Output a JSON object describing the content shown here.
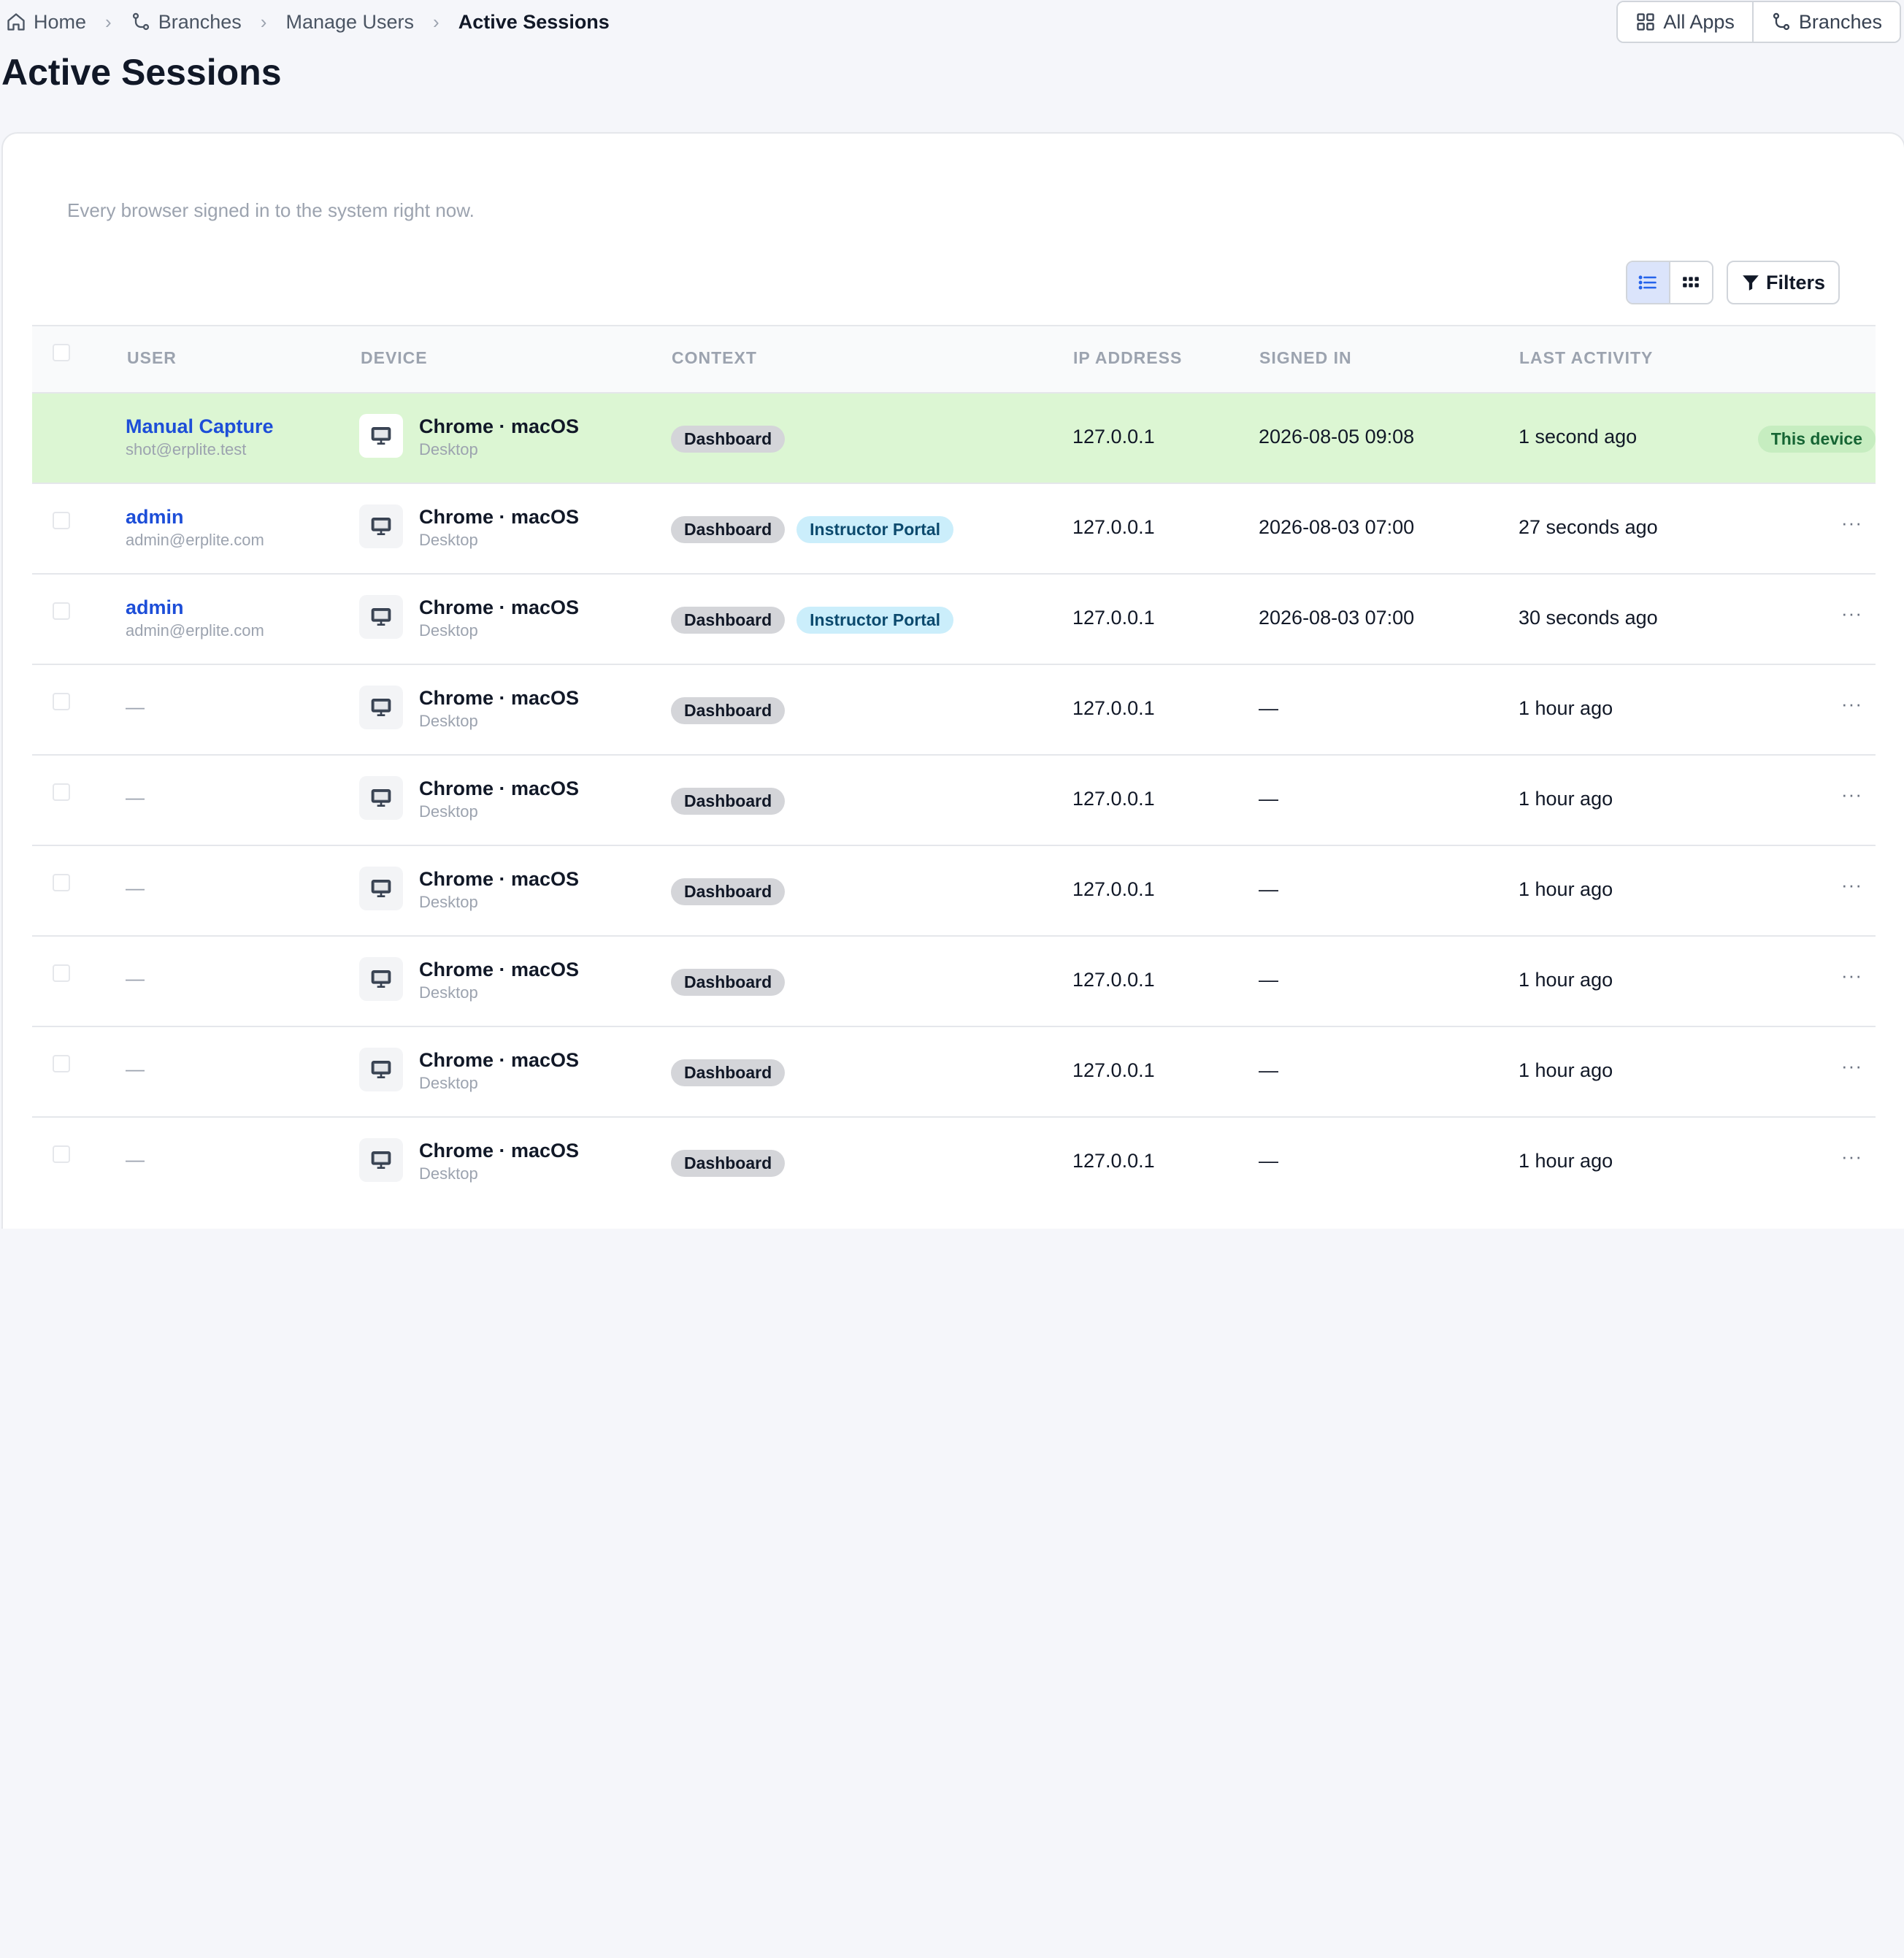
{
  "breadcrumb": {
    "items": [
      "Home",
      "Branches",
      "Manage Users"
    ],
    "current": "Active Sessions",
    "separator": "›"
  },
  "top_buttons": {
    "all_apps": "All Apps",
    "branches": "Branches"
  },
  "page": {
    "title": "Active Sessions"
  },
  "card": {
    "description": "Every browser signed in to the system right now."
  },
  "toolbar": {
    "filters": "Filters"
  },
  "table": {
    "columns": [
      "USER",
      "DEVICE",
      "CONTEXT",
      "IP ADDRESS",
      "SIGNED IN",
      "LAST ACTIVITY"
    ],
    "rows": [
      {
        "user_name": "Manual Capture",
        "user_email": "shot@erplite.test",
        "device": "Chrome · macOS",
        "device_type": "Desktop",
        "tags": [
          "Dashboard"
        ],
        "ip": "127.0.0.1",
        "signed_in": "2026-08-05 09:08",
        "last_activity": "1 second ago",
        "badge": "This device"
      },
      {
        "user_name": "admin",
        "user_email": "admin@erplite.com",
        "device": "Chrome · macOS",
        "device_type": "Desktop",
        "tags": [
          "Dashboard",
          "Instructor Portal"
        ],
        "ip": "127.0.0.1",
        "signed_in": "2026-08-03 07:00",
        "last_activity": "27 seconds ago",
        "action": "···"
      },
      {
        "user_name": "admin",
        "user_email": "admin@erplite.com",
        "device": "Chrome · macOS",
        "device_type": "Desktop",
        "tags": [
          "Dashboard",
          "Instructor Portal"
        ],
        "ip": "127.0.0.1",
        "signed_in": "2026-08-03 07:00",
        "last_activity": "30 seconds ago",
        "action": "···"
      },
      {
        "user_name": "—",
        "device": "Chrome · macOS",
        "device_type": "Desktop",
        "tags": [
          "Dashboard"
        ],
        "ip": "127.0.0.1",
        "signed_in": "—",
        "last_activity": "1 hour ago",
        "action": "···"
      },
      {
        "user_name": "—",
        "device": "Chrome · macOS",
        "device_type": "Desktop",
        "tags": [
          "Dashboard"
        ],
        "ip": "127.0.0.1",
        "signed_in": "—",
        "last_activity": "1 hour ago",
        "action": "···"
      },
      {
        "user_name": "—",
        "device": "Chrome · macOS",
        "device_type": "Desktop",
        "tags": [
          "Dashboard"
        ],
        "ip": "127.0.0.1",
        "signed_in": "—",
        "last_activity": "1 hour ago",
        "action": "···"
      },
      {
        "user_name": "—",
        "device": "Chrome · macOS",
        "device_type": "Desktop",
        "tags": [
          "Dashboard"
        ],
        "ip": "127.0.0.1",
        "signed_in": "—",
        "last_activity": "1 hour ago",
        "action": "···"
      },
      {
        "user_name": "—",
        "device": "Chrome · macOS",
        "device_type": "Desktop",
        "tags": [
          "Dashboard"
        ],
        "ip": "127.0.0.1",
        "signed_in": "—",
        "last_activity": "1 hour ago",
        "action": "···"
      },
      {
        "user_name": "—",
        "device": "Chrome · macOS",
        "device_type": "Desktop",
        "tags": [
          "Dashboard"
        ],
        "ip": "127.0.0.1",
        "signed_in": "—",
        "last_activity": "1 hour ago",
        "action": "···"
      }
    ]
  },
  "icons": {
    "home": "home-icon",
    "branch": "branch-icon",
    "apps": "grid-icon",
    "list_view": "list-view-icon",
    "grid_view": "grid-view-icon",
    "filter": "filter-icon",
    "desktop": "desktop-icon"
  },
  "colors": {
    "accent": "#1d4ed8",
    "current_row": "#dcf6d3",
    "this_device_badge": "#c6edc0",
    "portal_tag": "#cbeefb"
  }
}
